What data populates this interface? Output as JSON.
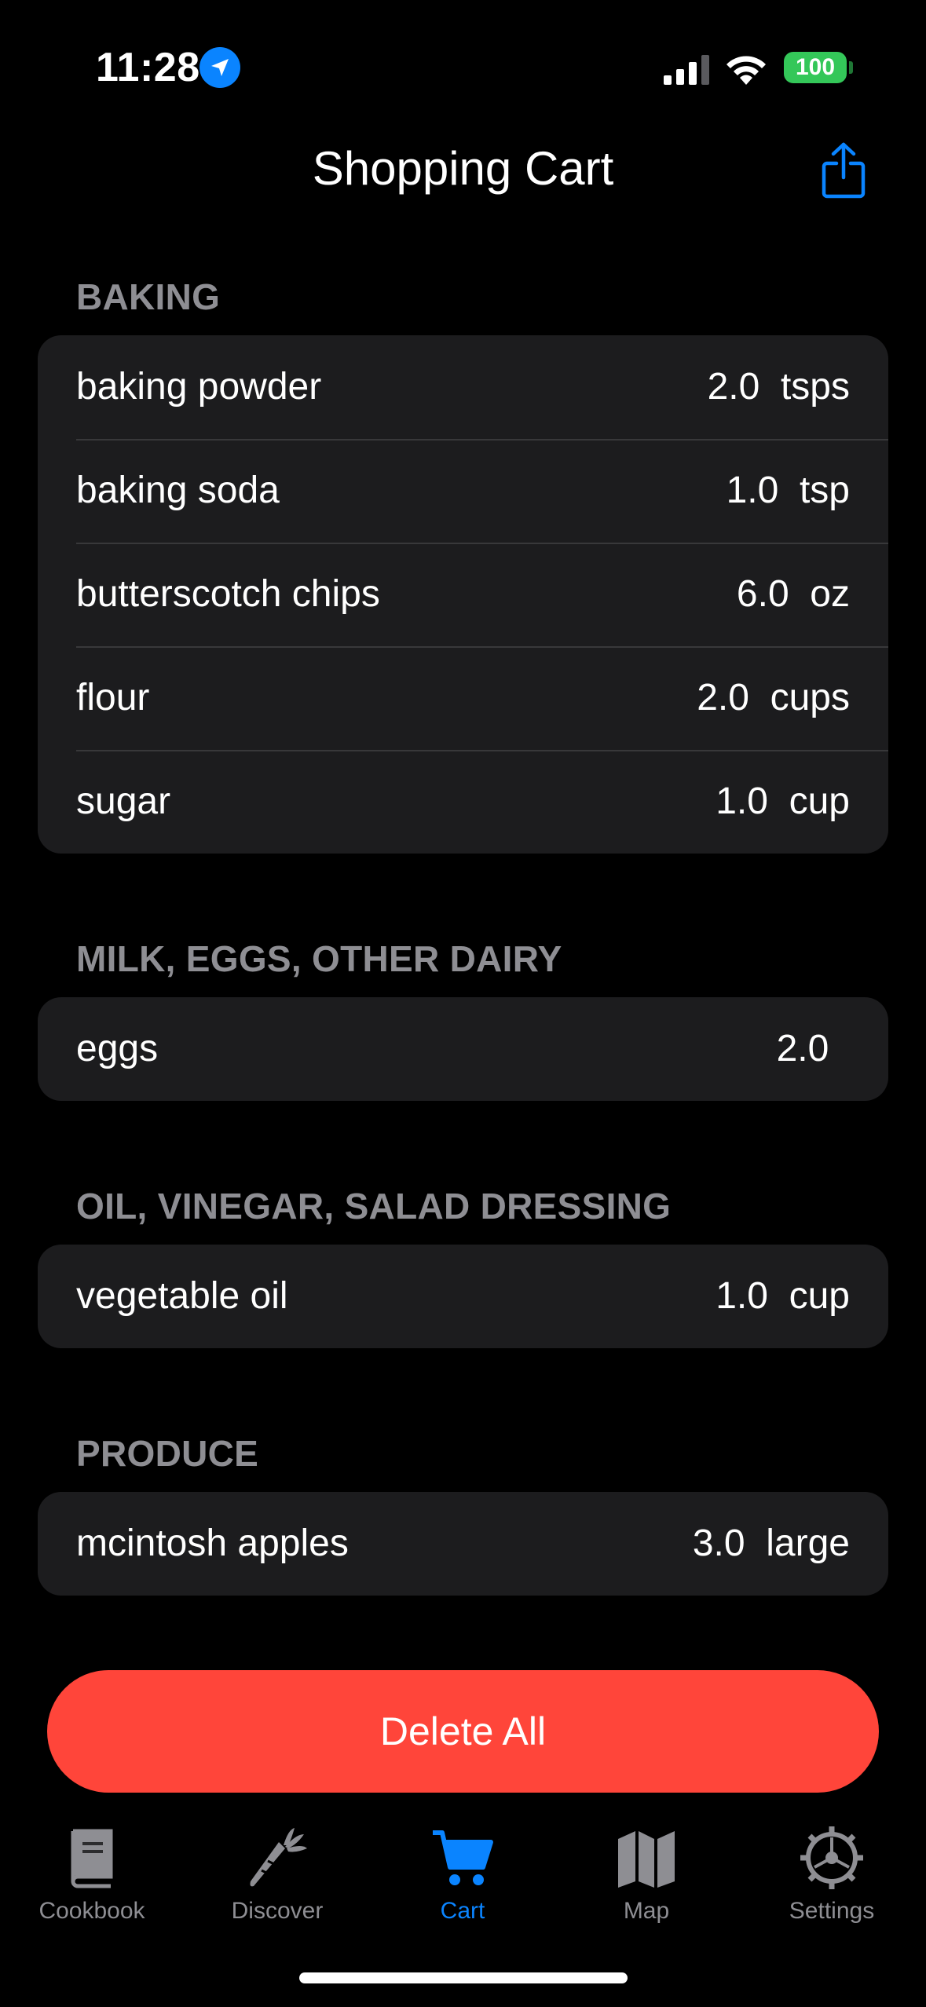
{
  "status_bar": {
    "time": "11:28",
    "battery": "100",
    "icons": [
      "location-arrow-icon",
      "cellular-signal-icon",
      "wifi-icon",
      "battery-icon"
    ]
  },
  "header": {
    "title": "Shopping Cart",
    "share_icon": "share-icon"
  },
  "sections": [
    {
      "title": "BAKING",
      "items": [
        {
          "name": "baking powder",
          "qty": "2.0  tsps"
        },
        {
          "name": "baking soda",
          "qty": "1.0  tsp"
        },
        {
          "name": "butterscotch chips",
          "qty": "6.0  oz"
        },
        {
          "name": "flour",
          "qty": "2.0  cups"
        },
        {
          "name": "sugar",
          "qty": "1.0  cup"
        }
      ]
    },
    {
      "title": "MILK, EGGS, OTHER DAIRY",
      "items": [
        {
          "name": "eggs",
          "qty": "2.0  "
        }
      ]
    },
    {
      "title": "OIL, VINEGAR, SALAD DRESSING",
      "items": [
        {
          "name": "vegetable oil",
          "qty": "1.0  cup"
        }
      ]
    },
    {
      "title": "PRODUCE",
      "items": [
        {
          "name": "mcintosh apples",
          "qty": "3.0  large"
        }
      ]
    }
  ],
  "actions": {
    "delete_all": "Delete All"
  },
  "tabs": [
    {
      "label": "Cookbook",
      "icon": "cookbook-icon",
      "active": false
    },
    {
      "label": "Discover",
      "icon": "carrot-icon",
      "active": false
    },
    {
      "label": "Cart",
      "icon": "cart-icon",
      "active": true
    },
    {
      "label": "Map",
      "icon": "map-icon",
      "active": false
    },
    {
      "label": "Settings",
      "icon": "gear-icon",
      "active": false
    }
  ],
  "colors": {
    "accent": "#0a84ff",
    "destructive": "#ff453a",
    "battery": "#34c759",
    "card": "#1c1c1e",
    "secondary_text": "#8e8e93"
  }
}
